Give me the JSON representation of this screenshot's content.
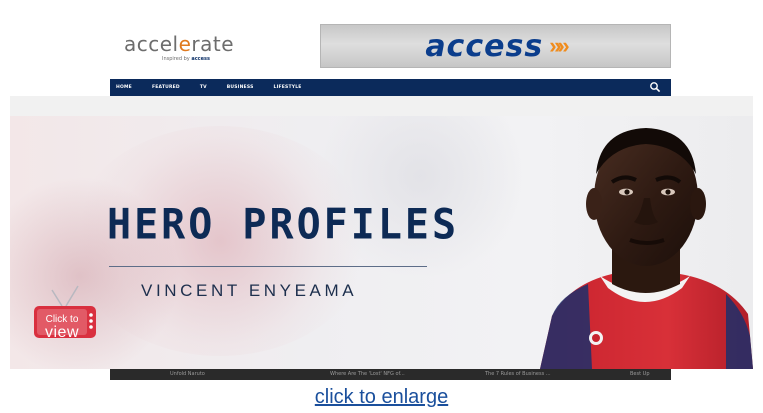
{
  "header": {
    "logo": {
      "word_prefix": "accel",
      "word_highlight": "e",
      "word_suffix": "rate",
      "tagline_prefix": "Inspired by",
      "tagline_brand": "access"
    },
    "banner": {
      "brand": "access",
      "chevrons": "»»",
      "accent_color": "#f08c1d",
      "brand_color": "#0b3d8c"
    }
  },
  "nav": {
    "items": [
      "HOME",
      "FEATURED",
      "TV",
      "BUSINESS",
      "LIFESTYLE"
    ],
    "search_icon": "search-icon",
    "background": "#0b2a5b"
  },
  "hero": {
    "title": "HERO PROFILES",
    "subtitle": "VINCENT ENYEAMA",
    "tv_badge": {
      "line1": "Click to",
      "line2": "view",
      "icon": "tv-icon",
      "color": "#d9303f"
    }
  },
  "bottom_strip": {
    "texts": [
      "Unfold Naruto",
      "Where Are The 'Lost' NFG of...",
      "The 7 Rules of Business ...",
      "Best Up"
    ]
  },
  "link": {
    "label": "click to enlarge"
  }
}
